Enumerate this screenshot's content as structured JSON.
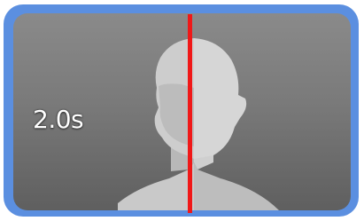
{
  "clip": {
    "duration_label": "2.0s",
    "thumbnail_icon": "person-silhouette-icon"
  },
  "colors": {
    "selection_border": "#5b8fe0",
    "playhead": "#f01818",
    "background_top": "#8a8a8a",
    "background_bottom": "#5f5f5f"
  }
}
